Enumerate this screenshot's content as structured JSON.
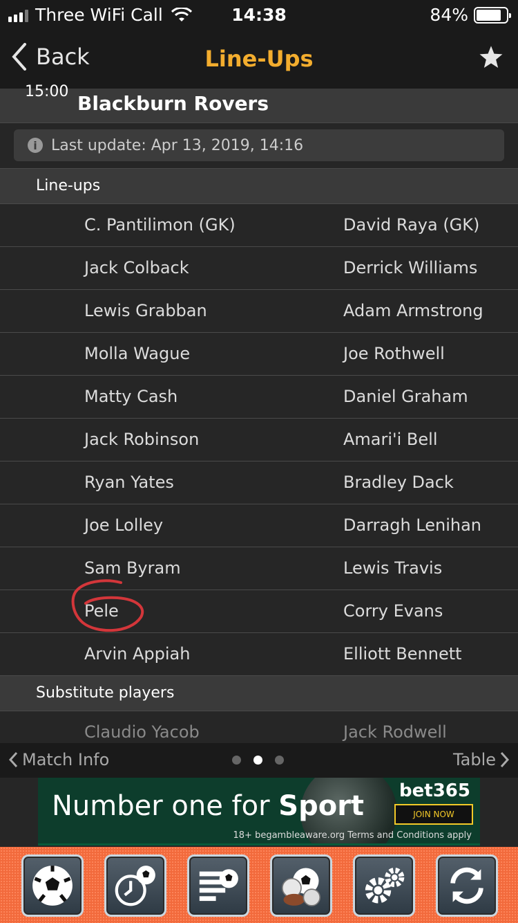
{
  "status_bar": {
    "carrier": "Three WiFi Call",
    "time": "14:38",
    "battery": "84%",
    "battery_level": 0.84
  },
  "nav": {
    "back_label": "Back",
    "title": "Line-Ups",
    "favorite_icon": "star-icon"
  },
  "match": {
    "kickoff": "15:00",
    "team": "Blackburn Rovers",
    "last_update": "Last update: Apr 13, 2019, 14:16"
  },
  "lineups": {
    "header": "Line-ups",
    "rows": [
      {
        "home": "C. Pantilimon (GK)",
        "away": "David Raya (GK)"
      },
      {
        "home": "Jack Colback",
        "away": "Derrick Williams"
      },
      {
        "home": "Lewis Grabban",
        "away": "Adam Armstrong"
      },
      {
        "home": "Molla Wague",
        "away": "Joe Rothwell"
      },
      {
        "home": "Matty Cash",
        "away": "Daniel Graham"
      },
      {
        "home": "Jack Robinson",
        "away": "Amari'i Bell"
      },
      {
        "home": "Ryan Yates",
        "away": "Bradley Dack"
      },
      {
        "home": "Joe Lolley",
        "away": "Darragh Lenihan"
      },
      {
        "home": "Sam Byram",
        "away": "Lewis Travis"
      },
      {
        "home": "Pele",
        "away": "Corry Evans"
      },
      {
        "home": "Arvin Appiah",
        "away": "Elliott Bennett"
      }
    ]
  },
  "substitutes": {
    "header": "Substitute players",
    "rows": [
      {
        "home": "Claudio Yacob",
        "away": "Jack Rodwell"
      }
    ]
  },
  "pager": {
    "prev_label": "Match Info",
    "next_label": "Table",
    "pages": 3,
    "current": 2
  },
  "ad": {
    "headline_prefix": "Number one for ",
    "headline_bold": "Sport",
    "brand": "bet365",
    "cta": "JOIN NOW",
    "fine_print": "18+ begambleaware.org Terms and Conditions apply"
  },
  "tabbar": [
    {
      "icon": "football-icon"
    },
    {
      "icon": "fixtures-clock-icon"
    },
    {
      "icon": "league-table-icon"
    },
    {
      "icon": "sports-balls-icon"
    },
    {
      "icon": "settings-gears-icon"
    },
    {
      "icon": "refresh-icon"
    }
  ]
}
